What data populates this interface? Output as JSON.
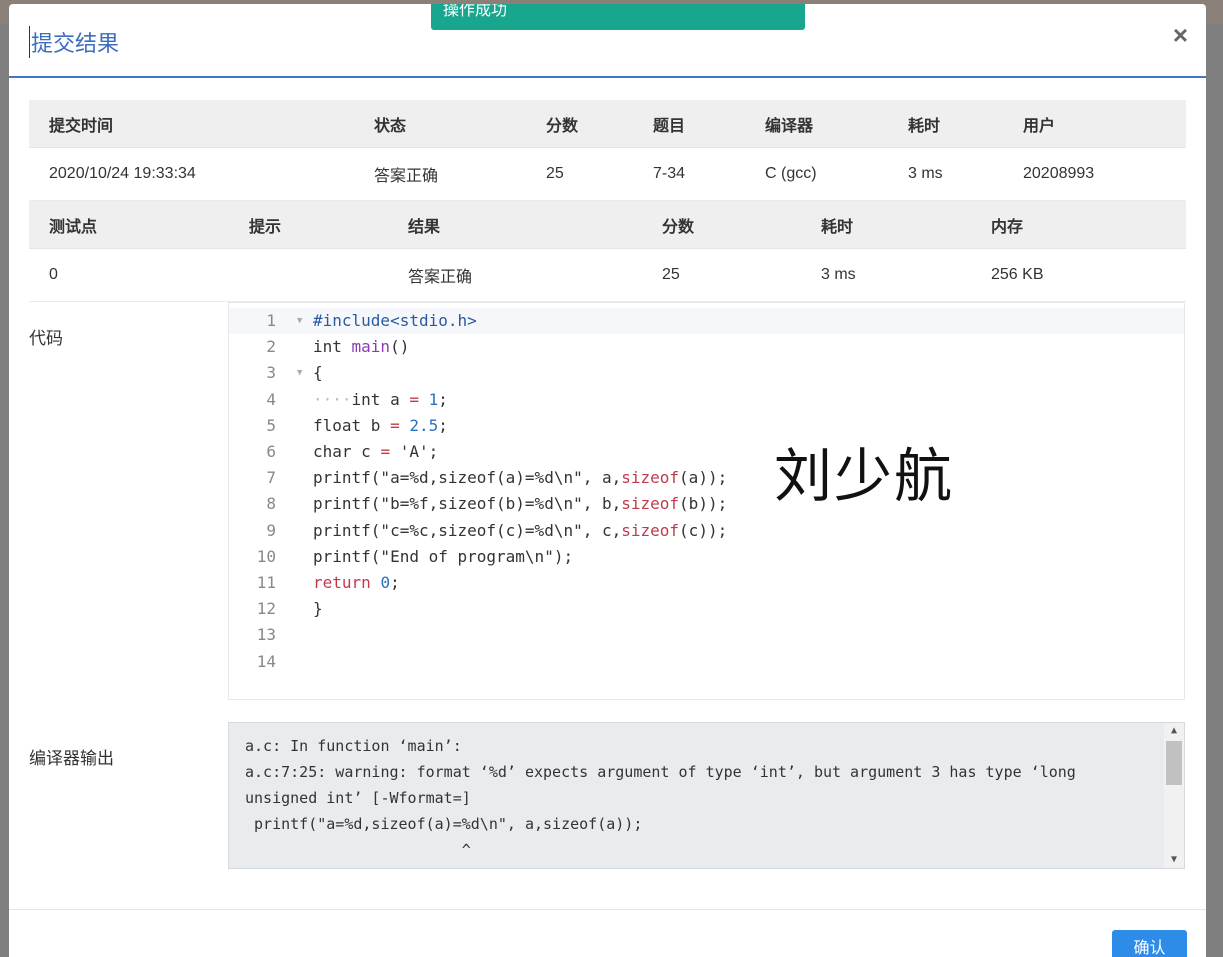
{
  "toast": "操作成功",
  "modal": {
    "title": "提交结果",
    "close": "×",
    "confirm": "确认"
  },
  "submission": {
    "headers": [
      "提交时间",
      "状态",
      "分数",
      "题目",
      "编译器",
      "耗时",
      "用户"
    ],
    "row": [
      "2020/10/24 19:33:34",
      "答案正确",
      "25",
      "7-34",
      "C (gcc)",
      "3 ms",
      "20208993"
    ]
  },
  "testcases": {
    "headers": [
      "测试点",
      "提示",
      "结果",
      "分数",
      "耗时",
      "内存"
    ],
    "row": [
      "0",
      "",
      "答案正确",
      "25",
      "3 ms",
      "256 KB"
    ]
  },
  "code_label": "代码",
  "code": {
    "line_numbers": [
      "1",
      "2",
      "3",
      "4",
      "5",
      "6",
      "7",
      "8",
      "9",
      "10",
      "11",
      "12",
      "13",
      "14"
    ],
    "lines": [
      "#include<stdio.h>",
      "int main()",
      "{",
      "    int a = 1;",
      "float b = 2.5;",
      "char c = 'A';",
      "printf(\"a=%d,sizeof(a)=%d\\n\", a,sizeof(a));",
      "printf(\"b=%f,sizeof(b)=%d\\n\", b,sizeof(b));",
      "printf(\"c=%c,sizeof(c)=%d\\n\", c,sizeof(c));",
      "printf(\"End of program\\n\");",
      "return 0;",
      "}",
      "",
      ""
    ]
  },
  "watermark": "刘少航",
  "compiler_label": "编译器输出",
  "compiler_output": "a.c: In function ‘main’:\na.c:7:25: warning: format ‘%d’ expects argument of type ‘int’, but argument 3 has type ‘long unsigned int’ [-Wformat=]\n printf(\"a=%d,sizeof(a)=%d\\n\", a,sizeof(a));\n                        ^"
}
